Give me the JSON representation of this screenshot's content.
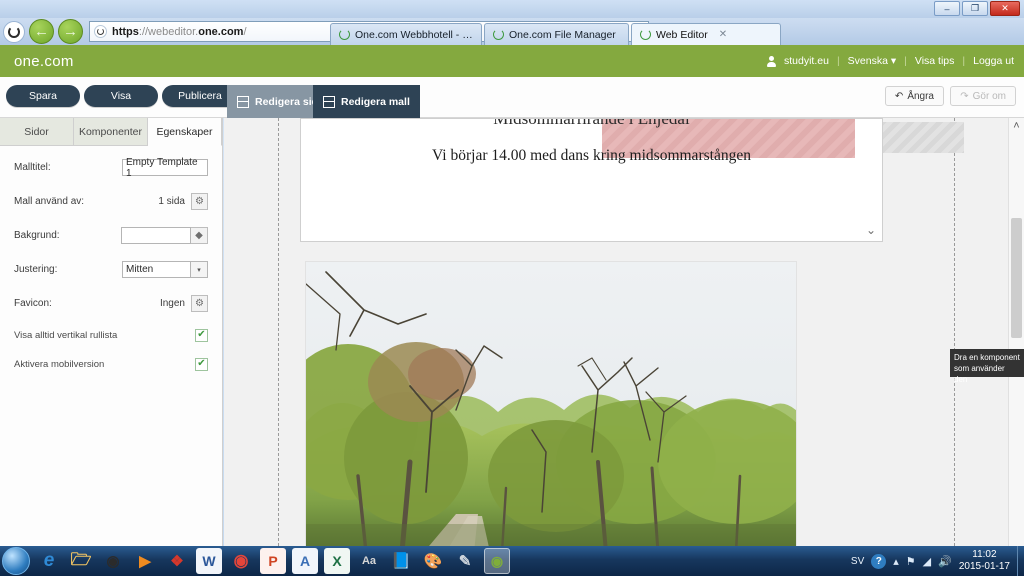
{
  "browser": {
    "url_scheme": "https",
    "url_rest": "://webeditor.",
    "url_domain": "one.com",
    "url_tail": "/",
    "url_full": "https://webeditor.one.com/",
    "back_glyph": "←",
    "forward_glyph": "→",
    "search_glyph": "⌕",
    "dropdown_glyph": "▾",
    "lock_glyph": "🔒",
    "refresh_glyph": "⟳",
    "minimize_glyph": "–",
    "restore_glyph": "❐",
    "close_glyph": "✕",
    "tabs": [
      {
        "label": "One.com Webbhotell  -  Domä...",
        "active": false
      },
      {
        "label": "One.com File Manager",
        "active": false
      },
      {
        "label": "Web Editor",
        "active": true,
        "close_glyph": "✕"
      }
    ]
  },
  "brand": {
    "logo": "one.com",
    "accent_color": "#84a93f",
    "user": "studyit.eu",
    "language": "Svenska",
    "language_caret": "▾",
    "tips": "Visa tips",
    "logout": "Logga ut",
    "separator": "|"
  },
  "toolbar": {
    "save_label": "Spara",
    "preview_label": "Visa",
    "publish_label": "Publicera",
    "edit_page_label": "Redigera sida",
    "edit_template_label": "Redigera mall",
    "undo_label": "Ångra",
    "undo_glyph": "↶",
    "redo_label": "Gör om",
    "redo_glyph": "↷"
  },
  "sidebar": {
    "tabs": [
      {
        "label": "Sidor",
        "active": false
      },
      {
        "label": "Komponenter",
        "active": false
      },
      {
        "label": "Egenskaper",
        "active": true
      }
    ],
    "fields": {
      "template_title_label": "Malltitel:",
      "template_title_value": "Empty Template 1",
      "used_by_label": "Mall använd av:",
      "used_by_value": "1 sida",
      "background_label": "Bakgrund:",
      "background_value": "",
      "alignment_label": "Justering:",
      "alignment_value": "Mitten",
      "favicon_label": "Favicon:",
      "favicon_value": "Ingen",
      "always_scrollbar_label": "Visa alltid vertikal rullista",
      "mobile_version_label": "Aktivera mobilversion",
      "gear_glyph": "⚙",
      "droplet_glyph": "◆",
      "caret_glyph": "▾",
      "check_glyph": "✔"
    }
  },
  "canvas": {
    "heading": "Midsommarfirande i Enjedal",
    "subtext": "Vi  börjar 14.00 med dans kring midsommarstången",
    "scroll_down_glyph": "⌄",
    "scroll_up_glyph": "˄",
    "tooltip_line1": "Dra en komponent",
    "tooltip_line2": "som använder den"
  },
  "taskbar": {
    "icons": [
      {
        "name": "internet-explorer",
        "glyph": "e",
        "color": "#2f8ad6",
        "bg": "transparent"
      },
      {
        "name": "file-explorer",
        "glyph": "🗀",
        "color": "#f0c463",
        "bg": "transparent"
      },
      {
        "name": "media-player",
        "glyph": "▶",
        "color": "#2b2b2b",
        "bg": "transparent"
      },
      {
        "name": "vlc-player",
        "glyph": "▶",
        "color": "#ef8b20",
        "bg": "transparent"
      },
      {
        "name": "adobe-reader",
        "glyph": "❖",
        "color": "#d7382b",
        "bg": "transparent"
      },
      {
        "name": "microsoft-word",
        "glyph": "W",
        "color": "#2b579a",
        "bg": "transparent"
      },
      {
        "name": "google-chrome",
        "glyph": "◉",
        "color": "#e5453a",
        "bg": "transparent"
      },
      {
        "name": "microsoft-powerpoint",
        "glyph": "P",
        "color": "#d04423",
        "bg": "transparent"
      },
      {
        "name": "adobe-acrobat",
        "glyph": "A",
        "color": "#3b6fb6",
        "bg": "transparent"
      },
      {
        "name": "microsoft-excel",
        "glyph": "X",
        "color": "#1d7044",
        "bg": "transparent"
      },
      {
        "name": "font-viewer",
        "glyph": "Aa",
        "color": "#9a9a9a",
        "bg": "transparent"
      },
      {
        "name": "notepad",
        "glyph": "📘",
        "color": "#9fd0ef",
        "bg": "transparent"
      },
      {
        "name": "paint",
        "glyph": "🎨",
        "color": "#e07b3a",
        "bg": "transparent"
      },
      {
        "name": "snipping-tool",
        "glyph": "✒",
        "color": "#cfd6dd",
        "bg": "transparent"
      },
      {
        "name": "one-com-webeditor",
        "glyph": "◌",
        "color": "#7fae3a",
        "bg": "active"
      }
    ],
    "tray": {
      "language": "SV",
      "help_glyph": "?",
      "chevron_glyph": "▴",
      "action_center_glyph": "⚑",
      "network_glyph": "◢",
      "volume_glyph": "🔊",
      "time": "11:02",
      "date": "2015-01-17"
    }
  }
}
